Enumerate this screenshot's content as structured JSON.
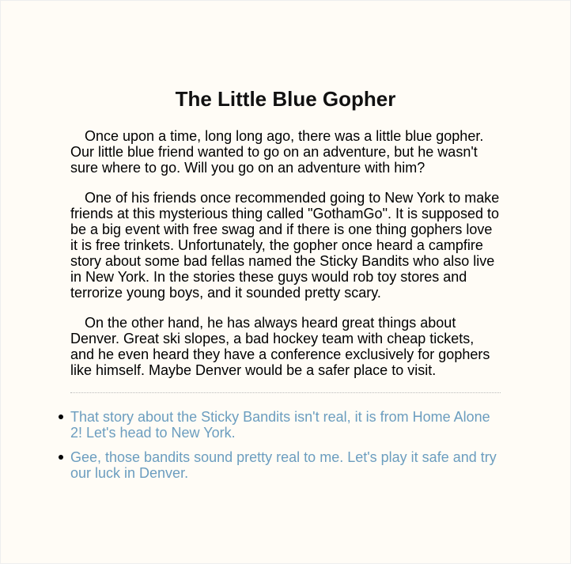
{
  "story": {
    "title": "The Little Blue Gopher",
    "paragraphs": [
      "Once upon a time, long long ago, there was a little blue gopher. Our little blue friend wanted to go on an adventure, but he wasn't sure where to go. Will you go on an adventure with him?",
      "One of his friends once recommended going to New York to make friends at this mysterious thing called \"GothamGo\". It is supposed to be a big event with free swag and if there is one thing gophers love it is free trinkets. Unfortunately, the gopher once heard a campfire story about some bad fellas named the Sticky Bandits who also live in New York. In the stories these guys would rob toy stores and terrorize young boys, and it sounded pretty scary.",
      "On the other hand, he has always heard great things about Denver. Great ski slopes, a bad hockey team with cheap tickets, and he even heard they have a conference exclusively for gophers like himself. Maybe Denver would be a safer place to visit."
    ],
    "options": [
      {
        "text": "That story about the Sticky Bandits isn't real, it is from Home Alone 2! Let's head to New York."
      },
      {
        "text": "Gee, those bandits sound pretty real to me. Let's play it safe and try our luck in Denver."
      }
    ]
  },
  "colors": {
    "background": "#fffcf6",
    "link": "#6b9dbf"
  }
}
